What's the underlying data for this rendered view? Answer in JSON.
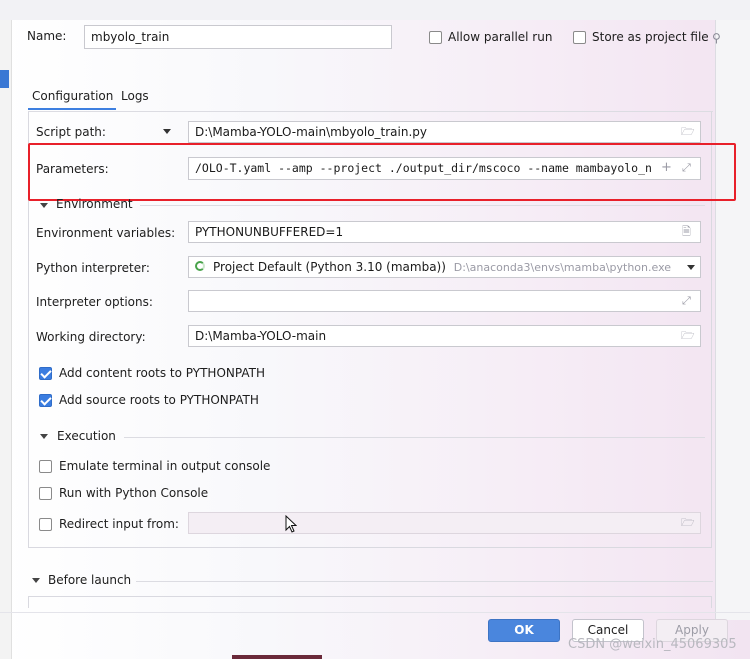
{
  "header": {
    "name_label": "Name:",
    "name_value": "mbyolo_train",
    "allow_parallel_label": "Allow parallel run",
    "store_as_project_label": "Store as project file"
  },
  "tabs": [
    {
      "label": "Configuration",
      "selected": true
    },
    {
      "label": "Logs",
      "selected": false
    }
  ],
  "form": {
    "script_path_label": "Script path:",
    "script_path_value": "D:\\Mamba-YOLO-main\\mbyolo_train.py",
    "parameters_label": "Parameters:",
    "parameters_value": "/OLO-T.yaml --amp --project ./output_dir/mscoco --name mambayolo_n",
    "environment_section": "Environment",
    "env_vars_label": "Environment variables:",
    "env_vars_value": "PYTHONUNBUFFERED=1",
    "interpreter_label": "Python interpreter:",
    "interpreter_value": "Project Default (Python 3.10 (mamba))",
    "interpreter_path": "D:\\anaconda3\\envs\\mamba\\python.exe",
    "interpreter_options_label": "Interpreter options:",
    "interpreter_options_value": "",
    "working_dir_label": "Working directory:",
    "working_dir_value": "D:\\Mamba-YOLO-main",
    "add_content_roots_label": "Add content roots to PYTHONPATH",
    "add_content_roots_checked": true,
    "add_source_roots_label": "Add source roots to PYTHONPATH",
    "add_source_roots_checked": true,
    "execution_section": "Execution",
    "emulate_terminal_label": "Emulate terminal in output console",
    "emulate_terminal_checked": false,
    "run_with_console_label": "Run with Python Console",
    "run_with_console_checked": false,
    "redirect_input_label": "Redirect input from:",
    "redirect_input_checked": false,
    "redirect_input_value": ""
  },
  "before_launch_label": "Before launch",
  "buttons": {
    "ok": "OK",
    "cancel": "Cancel",
    "apply": "Apply"
  },
  "watermark": "CSDN @weixin_45069305",
  "colors": {
    "highlight_box": "#e8202a",
    "primary_button": "#4a86dd",
    "checkbox_checked": "#3b7de0"
  }
}
